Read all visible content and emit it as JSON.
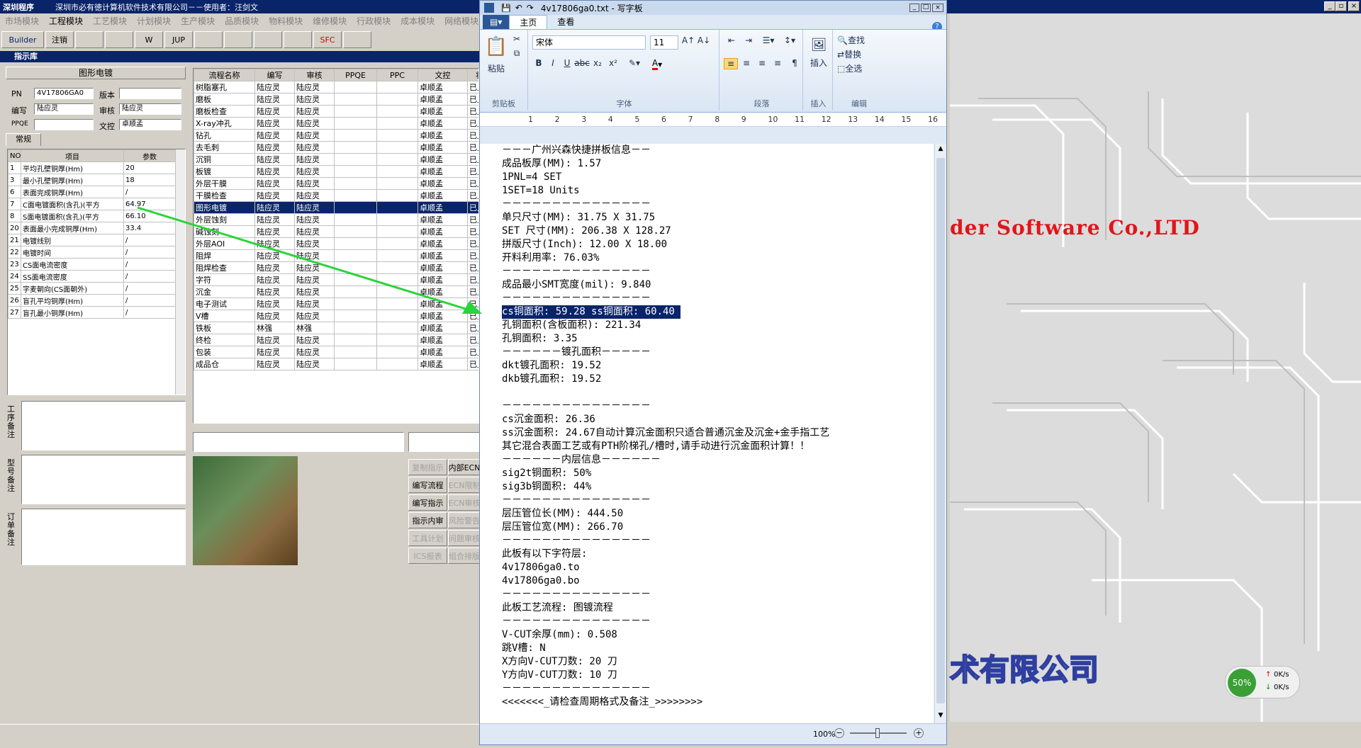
{
  "app": {
    "title_icon": "深圳程序",
    "title": "深圳市必有徳计算机软件技术有限公司－－使用者：汪剑文",
    "menu": [
      "市场模块",
      "工程模块",
      "工艺模块",
      "计划模块",
      "生产模块",
      "品质模块",
      "物料模块",
      "维修模块",
      "行政模块",
      "成本模块",
      "网络模块"
    ],
    "toolbar": [
      "Builder",
      "注销",
      "",
      "",
      "W",
      "JUP",
      "",
      "",
      "",
      "",
      "SFC",
      ""
    ]
  },
  "panel": {
    "title": "指示库",
    "section": "图形电镀",
    "pn_label": "PN",
    "pn_value": "4V17806GA0",
    "version_label": "版本",
    "version_value": "",
    "editor_label": "编写",
    "editor_value": "陆应灵",
    "review_label": "审核",
    "review_value": "陆应灵",
    "ppqe_label": "PPQE",
    "ppqe_value": "",
    "wenkong_label": "文控",
    "wenkong_value": "卓顺孟",
    "tab": "常规",
    "param_headers": [
      "NO",
      "项目",
      "参数"
    ],
    "params": [
      [
        "1",
        "平均孔壁铜厚(Hm)",
        "20"
      ],
      [
        "3",
        "最小孔壁铜厚(Hm)",
        "18"
      ],
      [
        "6",
        "表面完成铜厚(Hm)",
        "/"
      ],
      [
        "7",
        "C面电镀面积(含孔)(平方",
        "64.97"
      ],
      [
        "8",
        "S面电镀面积(含孔)(平方",
        "66.10"
      ],
      [
        "20",
        "表面最小完成铜厚(Hm)",
        "33.4"
      ],
      [
        "21",
        "电镀线别",
        "/"
      ],
      [
        "22",
        "电镀时间",
        "/"
      ],
      [
        "23",
        "CS面电流密度",
        "/"
      ],
      [
        "24",
        "SS面电流密度",
        "/"
      ],
      [
        "25",
        "字麦朝向(CS面朝外)",
        "/"
      ],
      [
        "26",
        "盲孔平均铜厚(Hm)",
        "/"
      ],
      [
        "27",
        "盲孔最小铜厚(Hm)",
        "/"
      ]
    ],
    "side_labels": [
      "工序备注",
      "型号备注",
      "订单备注"
    ],
    "flow_headers": [
      "流程名称",
      "编写",
      "审核",
      "PPQE",
      "PPC",
      "文控",
      "状"
    ],
    "flows": [
      [
        "树脂塞孔",
        "陆应灵",
        "陆应灵",
        "",
        "",
        "卓顺孟",
        "已上"
      ],
      [
        "磨板",
        "陆应灵",
        "陆应灵",
        "",
        "",
        "卓顺孟",
        "已上"
      ],
      [
        "磨板检查",
        "陆应灵",
        "陆应灵",
        "",
        "",
        "卓顺孟",
        "已上"
      ],
      [
        "X-ray冲孔",
        "陆应灵",
        "陆应灵",
        "",
        "",
        "卓顺孟",
        "已上"
      ],
      [
        "钻孔",
        "陆应灵",
        "陆应灵",
        "",
        "",
        "卓顺孟",
        "已上"
      ],
      [
        "去毛刺",
        "陆应灵",
        "陆应灵",
        "",
        "",
        "卓顺孟",
        "已上"
      ],
      [
        "沉铜",
        "陆应灵",
        "陆应灵",
        "",
        "",
        "卓顺孟",
        "已上"
      ],
      [
        "板镀",
        "陆应灵",
        "陆应灵",
        "",
        "",
        "卓顺孟",
        "已上"
      ],
      [
        "外层干膜",
        "陆应灵",
        "陆应灵",
        "",
        "",
        "卓顺孟",
        "已上"
      ],
      [
        "干膜检查",
        "陆应灵",
        "陆应灵",
        "",
        "",
        "卓顺孟",
        "已上"
      ],
      [
        "图形电镀",
        "陆应灵",
        "陆应灵",
        "",
        "",
        "卓顺孟",
        "已上"
      ],
      [
        "外层蚀刻",
        "陆应灵",
        "陆应灵",
        "",
        "",
        "卓顺孟",
        "已上"
      ],
      [
        "碱蚀刻",
        "陆应灵",
        "陆应灵",
        "",
        "",
        "卓顺孟",
        "已上"
      ],
      [
        "外层AOI",
        "陆应灵",
        "陆应灵",
        "",
        "",
        "卓顺孟",
        "已上"
      ],
      [
        "阻焊",
        "陆应灵",
        "陆应灵",
        "",
        "",
        "卓顺孟",
        "已上"
      ],
      [
        "阻焊检查",
        "陆应灵",
        "陆应灵",
        "",
        "",
        "卓顺孟",
        "已上"
      ],
      [
        "字符",
        "陆应灵",
        "陆应灵",
        "",
        "",
        "卓顺孟",
        "已上"
      ],
      [
        "沉金",
        "陆应灵",
        "陆应灵",
        "",
        "",
        "卓顺孟",
        "已上"
      ],
      [
        "电子测试",
        "陆应灵",
        "陆应灵",
        "",
        "",
        "卓顺孟",
        "已上"
      ],
      [
        "V槽",
        "陆应灵",
        "陆应灵",
        "",
        "",
        "卓顺孟",
        "已上"
      ],
      [
        "铁板",
        "林强",
        "林强",
        "",
        "",
        "卓顺孟",
        "已上"
      ],
      [
        "终检",
        "陆应灵",
        "陆应灵",
        "",
        "",
        "卓顺孟",
        "已上"
      ],
      [
        "包装",
        "陆应灵",
        "陆应灵",
        "",
        "",
        "卓顺孟",
        "已上"
      ],
      [
        "成品仓",
        "陆应灵",
        "陆应灵",
        "",
        "",
        "卓顺孟",
        "已上"
      ]
    ],
    "selected_flow_index": 10,
    "buttons_col1": [
      "复制指示",
      "编写流程",
      "编写指示",
      "指示内审",
      "工具计划",
      "ICS报表"
    ],
    "buttons_col2": [
      "内部ECN",
      "ECN限制",
      "ECN审核",
      "风险警告",
      "问题审核",
      "组合排版"
    ]
  },
  "bg": {
    "company_en": "der Software Co.,LTD",
    "company_cn": "术有限公司"
  },
  "wordpad": {
    "title": "4v17806ga0.txt - 写字板",
    "tabs": [
      "主页",
      "查看"
    ],
    "font": "宋体",
    "size": "11",
    "groups": [
      "剪贴板",
      "字体",
      "段落",
      "插入",
      "编辑"
    ],
    "paste": "粘贴",
    "insert": "插入",
    "find": "查找",
    "replace": "替换",
    "select_all": "全选",
    "ruler": [
      "1",
      "2",
      "3",
      "4",
      "5",
      "6",
      "7",
      "8",
      "9",
      "10",
      "11",
      "12",
      "13",
      "14",
      "15",
      "16"
    ],
    "zoom": "100%",
    "lines": [
      "－－－广州兴森快捷拼板信息－－",
      "成品板厚(MM): 1.57",
      "1PNL=4 SET",
      "1SET=18 Units",
      "－－－－－－－－－－－－－－－",
      "单只尺寸(MM): 31.75 X 31.75",
      "SET 尺寸(MM): 206.38 X 128.27",
      "拼版尺寸(Inch): 12.00 X 18.00",
      "开料利用率: 76.03%",
      "－－－－－－－－－－－－－－－",
      "成品最小SMT宽度(mil): 9.840",
      "－－－－－－－－－－－－－－－",
      "cs铜面积: 59.28",
      "ss铜面积: 60.40",
      "孔铜面积(含板面积): 221.34",
      "孔铜面积: 3.35",
      "－－－－－－镀孔面积－－－－－",
      "dkt镀孔面积: 19.52",
      "dkb镀孔面积: 19.52",
      "",
      "－－－－－－－－－－－－－－－",
      "cs沉金面积: 26.36",
      "ss沉金面积: 24.67自动计算沉金面积只适合普通沉金及沉金+金手指工艺",
      "其它混合表面工艺或有PTH阶梯孔/槽时,请手动进行沉金面积计算！！",
      "－－－－－－内层信息－－－－－－",
      "sig2t铜面积: 50%",
      "sig3b铜面积: 44%",
      "－－－－－－－－－－－－－－－",
      "层压管位长(MM): 444.50",
      "层压管位宽(MM): 266.70",
      "－－－－－－－－－－－－－－－",
      "此板有以下字符层:",
      "4v17806ga0.to",
      "4v17806ga0.bo",
      "－－－－－－－－－－－－－－－",
      "此板工艺流程: 图镀流程",
      "－－－－－－－－－－－－－－－",
      "V-CUT余厚(mm): 0.508",
      "跳V槽: N",
      "X方向V-CUT刀数: 20 刀",
      "Y方向V-CUT刀数: 10 刀",
      "－－－－－－－－－－－－－－－",
      "<<<<<<<_请检查周期格式及备注_>>>>>>>>"
    ]
  },
  "net": {
    "percent": "50%",
    "up": "0K/s",
    "down": "0K/s"
  }
}
